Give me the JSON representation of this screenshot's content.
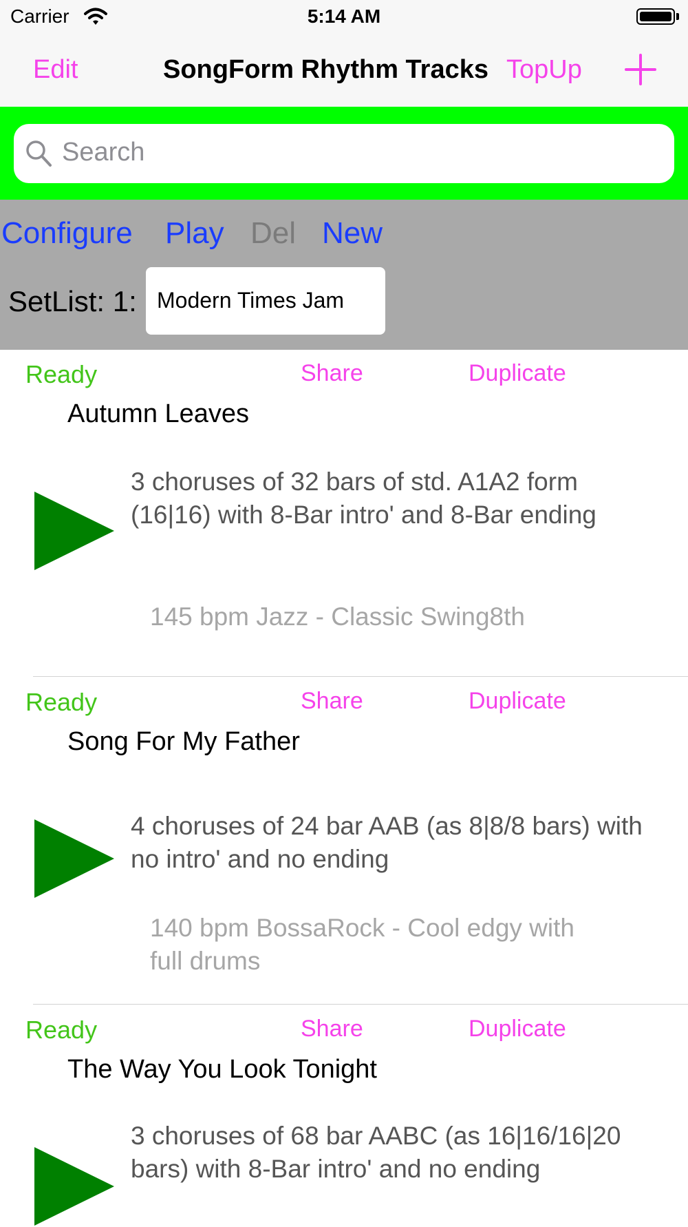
{
  "status_bar": {
    "carrier": "Carrier",
    "time": "5:14 AM"
  },
  "nav": {
    "edit_label": "Edit",
    "title": "SongForm Rhythm Tracks",
    "topup_label": "TopUp",
    "add_icon": "plus-icon"
  },
  "search": {
    "placeholder": "Search"
  },
  "toolbar": {
    "configure": "Configure",
    "play": "Play",
    "del": "Del",
    "new": "New"
  },
  "setlist": {
    "label": "SetList: 1:",
    "value": "Modern Times Jam"
  },
  "songs": [
    {
      "status": "Ready",
      "share": "Share",
      "duplicate": "Duplicate",
      "title": "Autumn Leaves",
      "description": "3 choruses of 32 bars of std. A1A2 form (16|16) with 8-Bar intro' and 8-Bar ending",
      "tempo": "145 bpm Jazz - Classic Swing8th"
    },
    {
      "status": "Ready",
      "share": "Share",
      "duplicate": "Duplicate",
      "title": "Song For My Father",
      "description": "4 choruses of 24 bar AAB (as 8|8/8 bars) with no intro' and no ending",
      "tempo": "140 bpm BossaRock - Cool edgy with full drums"
    },
    {
      "status": "Ready",
      "share": "Share",
      "duplicate": "Duplicate",
      "title": "The Way You Look Tonight",
      "description": "3 choruses of 68 bar AABC (as 16|16/16|20 bars) with 8-Bar intro' and no ending",
      "tempo": ""
    }
  ],
  "colors": {
    "accent": "#f542ea",
    "ready": "#43c51a",
    "play": "#008000",
    "search_bg": "#00ff00",
    "toolbar_bg": "#a9a9a9",
    "toolbar_link": "#1a3cff"
  }
}
